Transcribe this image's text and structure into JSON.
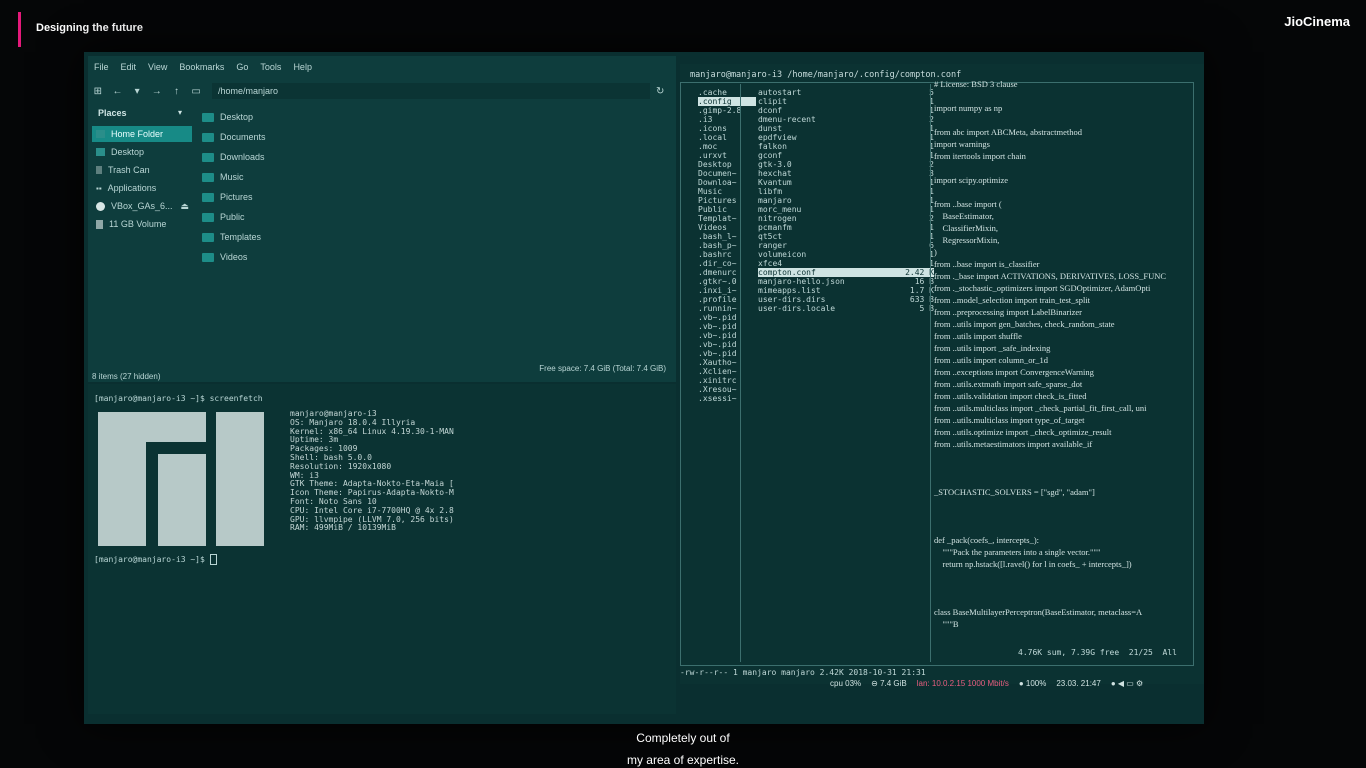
{
  "overlay": {
    "show_title": "Designing the future",
    "brand": "JioCinema",
    "subtitle_line1": "Completely out of",
    "subtitle_line2": "my area of expertise."
  },
  "file_manager": {
    "menu": [
      "File",
      "Edit",
      "View",
      "Bookmarks",
      "Go",
      "Tools",
      "Help"
    ],
    "path": "/home/manjaro",
    "places_title": "Places",
    "places": [
      "Home Folder",
      "Desktop",
      "Trash Can",
      "Applications",
      "VBox_GAs_6...",
      "11 GB Volume"
    ],
    "files": [
      "Desktop",
      "Documents",
      "Downloads",
      "Music",
      "Pictures",
      "Public",
      "Templates",
      "Videos"
    ],
    "status_left": "8 items (27 hidden)",
    "status_right": "Free space: 7.4 GiB (Total: 7.4 GiB)"
  },
  "terminal": {
    "prompt1": "[manjaro@manjaro-i3 ~]$ screenfetch",
    "info": [
      "manjaro@manjaro-i3",
      "OS: Manjaro 18.0.4 Illyria",
      "Kernel: x86_64 Linux 4.19.30-1-MAN",
      "Uptime: 3m",
      "Packages: 1009",
      "Shell: bash 5.0.0",
      "Resolution: 1920x1080",
      "WM: i3",
      "GTK Theme: Adapta-Nokto-Eta-Maia [",
      "Icon Theme: Papirus-Adapta-Nokto-M",
      "Font: Noto Sans 10",
      "CPU: Intel Core i7-7700HQ @ 4x 2.8",
      "GPU: llvmpipe (LLVM 7.0, 256 bits)",
      "RAM: 499MiB / 10139MiB"
    ],
    "prompt2": "[manjaro@manjaro-i3 ~]$ "
  },
  "ranger": {
    "title": "manjaro@manjaro-i3 /home/manjaro/.config/compton.conf",
    "col1": [
      ".cache",
      ".config",
      ".gimp-2.8",
      ".i3",
      ".icons",
      ".local",
      ".moc",
      ".urxvt",
      "Desktop",
      "Documen~",
      "Downloa~",
      "Music",
      "Pictures",
      "Public",
      "Templat~",
      "Videos",
      ".bash_l~",
      ".bash_p~",
      ".bashrc",
      ".dir_co~",
      ".dmenurc",
      ".gtkr~.0",
      ".inxi_i~",
      ".profile",
      ".runnin~",
      ".vb~.pid",
      ".vb~.pid",
      ".vb~.pid",
      ".vb~.pid",
      ".vb~.pid",
      ".Xautho~",
      ".Xclien~",
      ".xinitrc",
      ".Xresou~",
      ".xsessi~"
    ],
    "col2": [
      {
        "name": "autostart",
        "size": "5"
      },
      {
        "name": "clipit",
        "size": "1"
      },
      {
        "name": "dconf",
        "size": "1"
      },
      {
        "name": "dmenu-recent",
        "size": "2"
      },
      {
        "name": "dunst",
        "size": "1"
      },
      {
        "name": "epdfview",
        "size": "1"
      },
      {
        "name": "falkon",
        "size": "1"
      },
      {
        "name": "gconf",
        "size": "1"
      },
      {
        "name": "gtk-3.0",
        "size": "2"
      },
      {
        "name": "hexchat",
        "size": "3"
      },
      {
        "name": "Kvantum",
        "size": "1"
      },
      {
        "name": "libfm",
        "size": "1"
      },
      {
        "name": "manjaro",
        "size": "1"
      },
      {
        "name": "morc_menu",
        "size": "1"
      },
      {
        "name": "nitrogen",
        "size": "2"
      },
      {
        "name": "pcmanfm",
        "size": "1"
      },
      {
        "name": "qt5ct",
        "size": "1"
      },
      {
        "name": "ranger",
        "size": "6"
      },
      {
        "name": "volumeicon",
        "size": "1"
      },
      {
        "name": "xfce4",
        "size": "1"
      },
      {
        "name": "compton.conf",
        "size": "2.42 K"
      },
      {
        "name": "manjaro-hello.json",
        "size": "16 B"
      },
      {
        "name": "mimeapps.list",
        "size": "1.7 K"
      },
      {
        "name": "user-dirs.dirs",
        "size": "633 B"
      },
      {
        "name": "user-dirs.locale",
        "size": "5 B"
      }
    ],
    "code": [
      "# License: BSD 3 clause",
      "",
      "import numpy as np",
      "",
      "from abc import ABCMeta, abstractmethod",
      "import warnings",
      "from itertools import chain",
      "",
      "import scipy.optimize",
      "",
      "from ..base import (",
      "    BaseEstimator,",
      "    ClassifierMixin,",
      "    RegressorMixin,",
      ")",
      "from ..base import is_classifier",
      "from ._base import ACTIVATIONS, DERIVATIVES, LOSS_FUNC",
      "from ._stochastic_optimizers import SGDOptimizer, AdamOpti",
      "from ..model_selection import train_test_split",
      "from ..preprocessing import LabelBinarizer",
      "from ..utils import gen_batches, check_random_state",
      "from ..utils import shuffle",
      "from ..utils import _safe_indexing",
      "from ..utils import column_or_1d",
      "from ..exceptions import ConvergenceWarning",
      "from ..utils.extmath import safe_sparse_dot",
      "from ..utils.validation import check_is_fitted",
      "from ..utils.multiclass import _check_partial_fit_first_call, uni",
      "from ..utils.multiclass import type_of_target",
      "from ..utils.optimize import _check_optimize_result",
      "from ..utils.metaestimators import available_if",
      "",
      "",
      "",
      "_STOCHASTIC_SOLVERS = [\"sgd\", \"adam\"]",
      "",
      "",
      "",
      "def _pack(coefs_, intercepts_):",
      "    \"\"\"Pack the parameters into a single vector.\"\"\"",
      "    return np.hstack([l.ravel() for l in coefs_ + intercepts_])",
      "",
      "",
      "",
      "class BaseMultilayerPerceptron(BaseEstimator, metaclass=A",
      "    \"\"\"B"
    ],
    "bottom_left": "-rw-r--r-- 1 manjaro manjaro 2.42K 2018-10-31 21:31",
    "bottom_right": "4.76K sum, 7.39G free  21/25  All"
  },
  "statusbar": {
    "cpu": "cpu  03%",
    "disk": "⊖ 7.4 GiB",
    "lan": "lan: 10.0.2.15 1000 Mbit/s",
    "battery": "● 100%",
    "time": "23.03. 21:47"
  }
}
